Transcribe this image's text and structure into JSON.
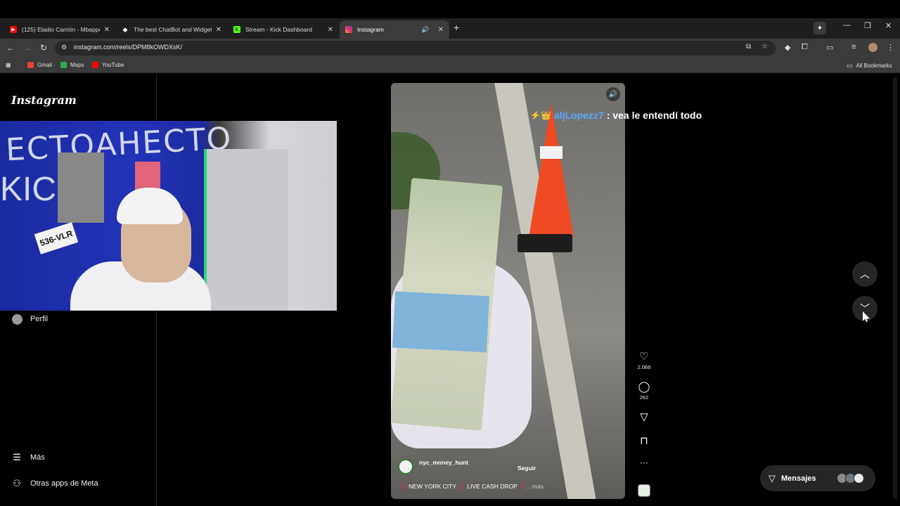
{
  "browser": {
    "tabs": [
      {
        "title": "(125) Eladio Carrión - Mbappe",
        "favicon_color": "#ff0000"
      },
      {
        "title": "The best ChatBot and Widgets",
        "favicon_color": "#ffffff"
      },
      {
        "title": "Stream - Kick Dashboard",
        "favicon_color": "#53fc18"
      },
      {
        "title": "Instagram",
        "favicon_color": "#e1306c"
      }
    ],
    "url": "instagram.com/reels/DPM8kOWDXsK/",
    "bookmarks": [
      {
        "label": "Gmail",
        "color": "#ea4335"
      },
      {
        "label": "Maps",
        "color": "#34a853"
      },
      {
        "label": "YouTube",
        "color": "#ff0000"
      }
    ],
    "all_bookmarks": "All Bookmarks"
  },
  "instagram": {
    "logo": "Instagram",
    "sidebar": {
      "profile": "Perfil",
      "more": "Más",
      "meta_apps": "Otras apps de Meta"
    },
    "webcam": {
      "plate_text": "536-VLR"
    },
    "reel": {
      "username": "nyc_money_hunt",
      "follow": "Seguir",
      "caption_a": "NEW YORK CITY",
      "caption_b": "LIVE CASH DROP",
      "caption_more": "... más",
      "likes": "2.066",
      "comments": "262"
    },
    "chat": {
      "user": "aljLopezz7",
      "separator": ":",
      "message": "vea le entendí todo"
    },
    "messages_label": "Mensajes"
  }
}
